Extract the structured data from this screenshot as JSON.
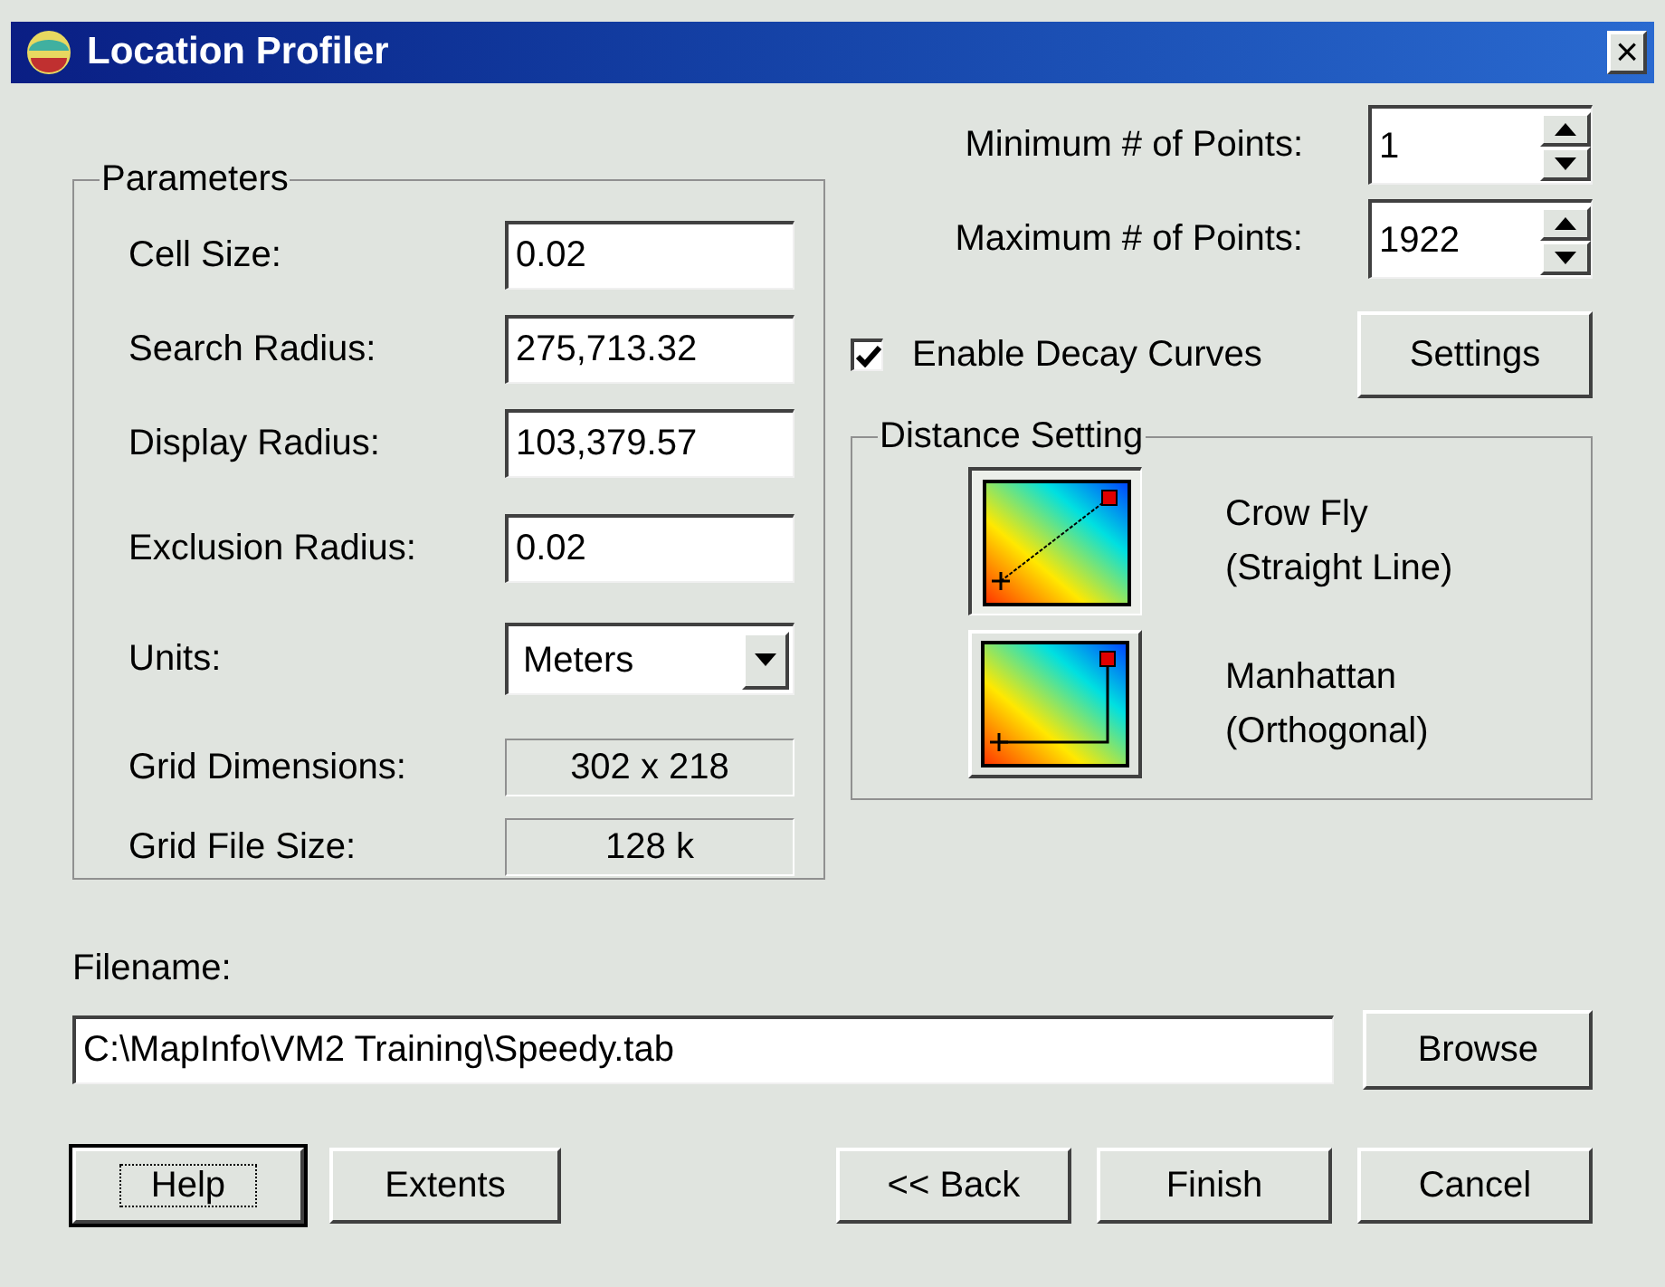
{
  "window": {
    "title": "Location Profiler",
    "close": "×"
  },
  "parameters": {
    "title": "Parameters",
    "fields": [
      {
        "kind": "input",
        "label": "Cell Size:",
        "value": "0.02"
      },
      {
        "kind": "input",
        "label": "Search Radius:",
        "value": "275,713.32"
      },
      {
        "kind": "input",
        "label": "Display Radius:",
        "value": "103,379.57"
      },
      {
        "kind": "input",
        "label": "Exclusion Radius:",
        "value": "0.02"
      },
      {
        "kind": "dropdown",
        "label": "Units:",
        "value": "Meters"
      },
      {
        "kind": "readout",
        "label": "Grid Dimensions:",
        "value": "302 x 218"
      },
      {
        "kind": "readout",
        "label": "Grid File Size:",
        "value": "128 k"
      }
    ]
  },
  "points": [
    {
      "label": "Minimum # of Points:",
      "value": "1"
    },
    {
      "label": "Maximum # of Points:",
      "value": "1922"
    }
  ],
  "decay": {
    "label": "Enable Decay Curves",
    "checked": true,
    "button": "Settings"
  },
  "distance": {
    "title": "Distance Setting",
    "options": [
      {
        "kind": "straight",
        "line1": "Crow Fly",
        "line2": "(Straight Line)",
        "selected": true
      },
      {
        "kind": "orthogonal",
        "line1": "Manhattan",
        "line2": "(Orthogonal)",
        "selected": false
      }
    ]
  },
  "filename": {
    "label": "Filename:",
    "value": "C:\\MapInfo\\VM2 Training\\Speedy.tab",
    "button": "Browse"
  },
  "buttons_left": [
    {
      "label": "Help",
      "focused": true
    },
    {
      "label": "Extents",
      "focused": false
    }
  ],
  "buttons_right": [
    {
      "label": "<< Back",
      "focused": false
    },
    {
      "label": "Finish",
      "focused": false
    },
    {
      "label": "Cancel",
      "focused": false
    }
  ]
}
